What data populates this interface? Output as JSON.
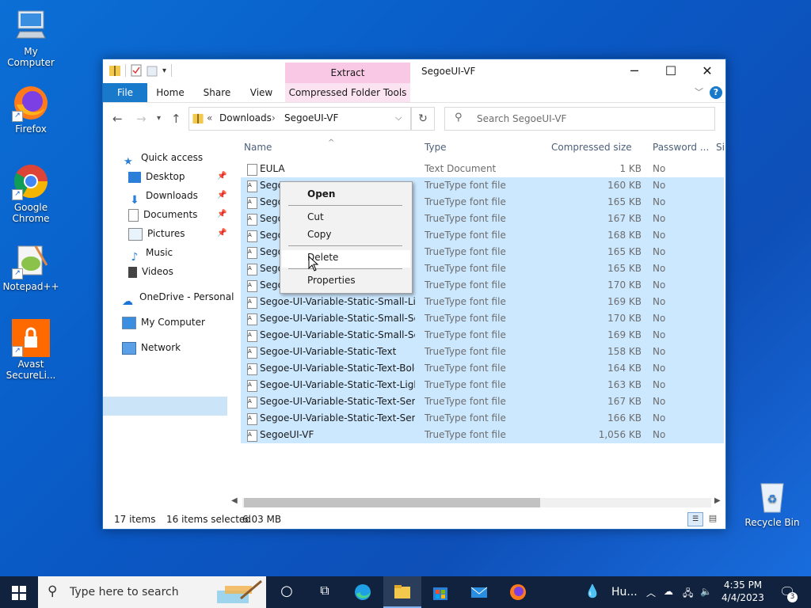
{
  "desktop": {
    "icons": [
      {
        "label": "My Computer"
      },
      {
        "label": "Firefox"
      },
      {
        "label": "Google Chrome"
      },
      {
        "label": "Notepad++"
      },
      {
        "label": "Avast SecureLi..."
      },
      {
        "label": "Recycle Bin"
      }
    ]
  },
  "window": {
    "title": "SegoeUI-VF",
    "context_tab": "Extract",
    "tabs": {
      "file": "File",
      "home": "Home",
      "share": "Share",
      "view": "View",
      "tools": "Compressed Folder Tools"
    },
    "help": "?",
    "address": {
      "overflow": "«",
      "crumbs": [
        "Downloads",
        "SegoeUI-VF"
      ]
    },
    "search_placeholder": "Search SegoeUI-VF",
    "accent": "#1979ca",
    "context_tab_color": "#f8c8e4"
  },
  "sidebar": {
    "quick_access": "Quick access",
    "items": [
      {
        "label": "Desktop",
        "pinned": true
      },
      {
        "label": "Downloads",
        "pinned": true
      },
      {
        "label": "Documents",
        "pinned": true
      },
      {
        "label": "Pictures",
        "pinned": true
      },
      {
        "label": "Music",
        "pinned": false
      },
      {
        "label": "Videos",
        "pinned": false
      }
    ],
    "onedrive": "OneDrive - Personal",
    "this_pc": "My Computer",
    "network": "Network"
  },
  "columns": {
    "name": "Name",
    "type": "Type",
    "size": "Compressed size",
    "password": "Password ...",
    "extra": "Si"
  },
  "files": [
    {
      "name": "EULA",
      "type": "Text Document",
      "size": "1 KB",
      "password": "No",
      "selected": false
    },
    {
      "name": "Segoe",
      "type": "TrueType font file",
      "size": "160 KB",
      "password": "No",
      "selected": true
    },
    {
      "name": "Sego",
      "type": "TrueType font file",
      "size": "165 KB",
      "password": "No",
      "selected": true
    },
    {
      "name": "Sego",
      "type": "TrueType font file",
      "size": "167 KB",
      "password": "No",
      "selected": true
    },
    {
      "name": "Sego",
      "type": "TrueType font file",
      "size": "168 KB",
      "password": "No",
      "selected": true
    },
    {
      "name": "Sego",
      "type": "TrueType font file",
      "size": "165 KB",
      "password": "No",
      "selected": true
    },
    {
      "name": "Sego",
      "type": "TrueType font file",
      "size": "165 KB",
      "password": "No",
      "selected": true
    },
    {
      "name": "Sego",
      "type": "TrueType font file",
      "size": "170 KB",
      "password": "No",
      "selected": true
    },
    {
      "name": "Segoe-UI-Variable-Static-Small-Light",
      "type": "TrueType font file",
      "size": "169 KB",
      "password": "No",
      "selected": true
    },
    {
      "name": "Segoe-UI-Variable-Static-Small-Se...",
      "type": "TrueType font file",
      "size": "170 KB",
      "password": "No",
      "selected": true
    },
    {
      "name": "Segoe-UI-Variable-Static-Small-Se...",
      "type": "TrueType font file",
      "size": "169 KB",
      "password": "No",
      "selected": true
    },
    {
      "name": "Segoe-UI-Variable-Static-Text",
      "type": "TrueType font file",
      "size": "158 KB",
      "password": "No",
      "selected": true
    },
    {
      "name": "Segoe-UI-Variable-Static-Text-Bold",
      "type": "TrueType font file",
      "size": "164 KB",
      "password": "No",
      "selected": true
    },
    {
      "name": "Segoe-UI-Variable-Static-Text-Light",
      "type": "TrueType font file",
      "size": "163 KB",
      "password": "No",
      "selected": true
    },
    {
      "name": "Segoe-UI-Variable-Static-Text-Semi...",
      "type": "TrueType font file",
      "size": "167 KB",
      "password": "No",
      "selected": true
    },
    {
      "name": "Segoe-UI-Variable-Static-Text-Semi...",
      "type": "TrueType font file",
      "size": "166 KB",
      "password": "No",
      "selected": true
    },
    {
      "name": "SegoeUI-VF",
      "type": "TrueType font file",
      "size": "1,056 KB",
      "password": "No",
      "selected": true
    }
  ],
  "status": {
    "items": "17 items",
    "selected": "16 items selected",
    "size": "6.03 MB"
  },
  "context_menu": {
    "open": "Open",
    "cut": "Cut",
    "copy": "Copy",
    "delete": "Delete",
    "properties": "Properties"
  },
  "taskbar": {
    "search_placeholder": "Type here to search",
    "weather": "Hu...",
    "time": "4:35 PM",
    "date": "4/4/2023",
    "notifications": "3"
  }
}
